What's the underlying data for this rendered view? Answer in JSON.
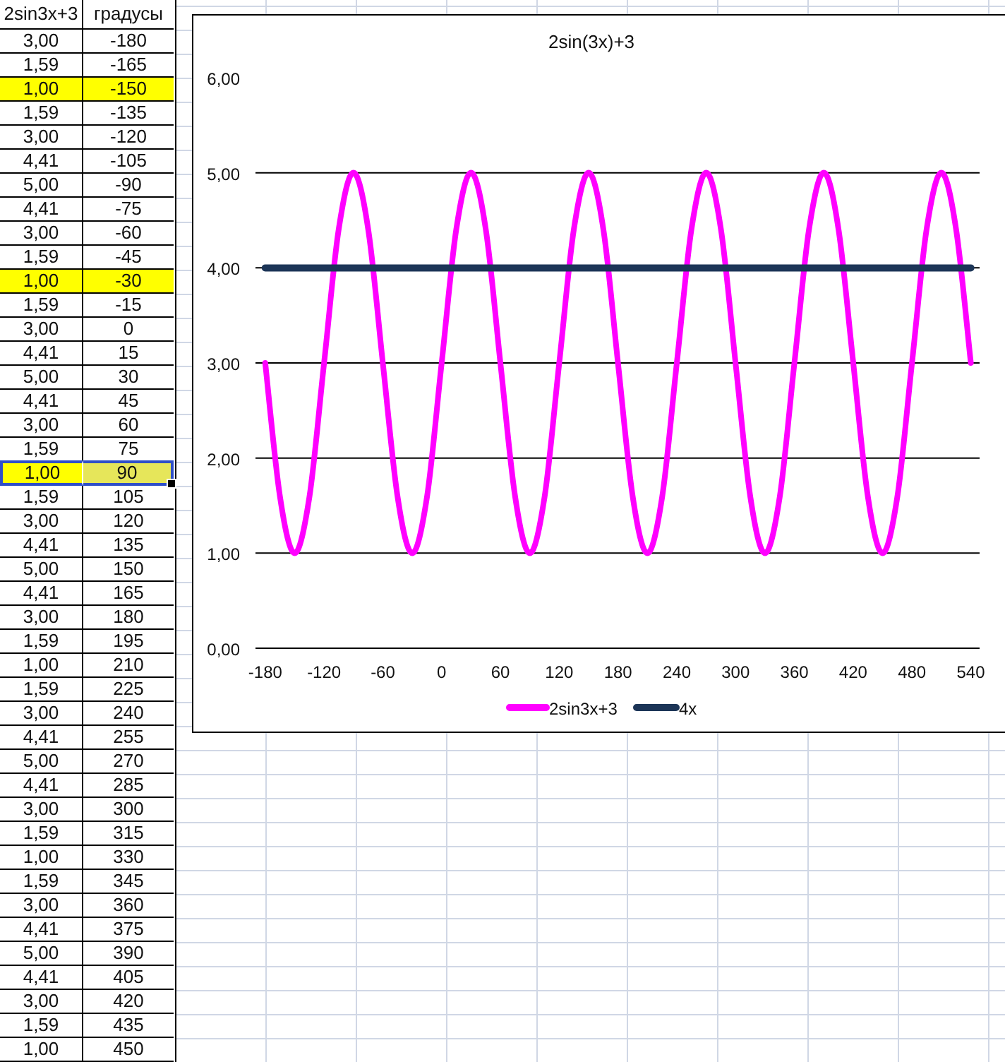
{
  "table": {
    "columns": [
      "2sin3x+3",
      "градусы"
    ],
    "rows": [
      {
        "values": [
          "3,00",
          "-180"
        ],
        "highlighted": false,
        "selected": false
      },
      {
        "values": [
          "1,59",
          "-165"
        ],
        "highlighted": false,
        "selected": false
      },
      {
        "values": [
          "1,00",
          "-150"
        ],
        "highlighted": true,
        "selected": false
      },
      {
        "values": [
          "1,59",
          "-135"
        ],
        "highlighted": false,
        "selected": false
      },
      {
        "values": [
          "3,00",
          "-120"
        ],
        "highlighted": false,
        "selected": false
      },
      {
        "values": [
          "4,41",
          "-105"
        ],
        "highlighted": false,
        "selected": false
      },
      {
        "values": [
          "5,00",
          "-90"
        ],
        "highlighted": false,
        "selected": false
      },
      {
        "values": [
          "4,41",
          "-75"
        ],
        "highlighted": false,
        "selected": false
      },
      {
        "values": [
          "3,00",
          "-60"
        ],
        "highlighted": false,
        "selected": false
      },
      {
        "values": [
          "1,59",
          "-45"
        ],
        "highlighted": false,
        "selected": false
      },
      {
        "values": [
          "1,00",
          "-30"
        ],
        "highlighted": true,
        "selected": false
      },
      {
        "values": [
          "1,59",
          "-15"
        ],
        "highlighted": false,
        "selected": false
      },
      {
        "values": [
          "3,00",
          "0"
        ],
        "highlighted": false,
        "selected": false
      },
      {
        "values": [
          "4,41",
          "15"
        ],
        "highlighted": false,
        "selected": false
      },
      {
        "values": [
          "5,00",
          "30"
        ],
        "highlighted": false,
        "selected": false
      },
      {
        "values": [
          "4,41",
          "45"
        ],
        "highlighted": false,
        "selected": false
      },
      {
        "values": [
          "3,00",
          "60"
        ],
        "highlighted": false,
        "selected": false
      },
      {
        "values": [
          "1,59",
          "75"
        ],
        "highlighted": false,
        "selected": false
      },
      {
        "values": [
          "1,00",
          "90"
        ],
        "highlighted": true,
        "selected": true
      },
      {
        "values": [
          "1,59",
          "105"
        ],
        "highlighted": false,
        "selected": false
      },
      {
        "values": [
          "3,00",
          "120"
        ],
        "highlighted": false,
        "selected": false
      },
      {
        "values": [
          "4,41",
          "135"
        ],
        "highlighted": false,
        "selected": false
      },
      {
        "values": [
          "5,00",
          "150"
        ],
        "highlighted": false,
        "selected": false
      },
      {
        "values": [
          "4,41",
          "165"
        ],
        "highlighted": false,
        "selected": false
      },
      {
        "values": [
          "3,00",
          "180"
        ],
        "highlighted": false,
        "selected": false
      },
      {
        "values": [
          "1,59",
          "195"
        ],
        "highlighted": false,
        "selected": false
      },
      {
        "values": [
          "1,00",
          "210"
        ],
        "highlighted": false,
        "selected": false
      },
      {
        "values": [
          "1,59",
          "225"
        ],
        "highlighted": false,
        "selected": false
      },
      {
        "values": [
          "3,00",
          "240"
        ],
        "highlighted": false,
        "selected": false
      },
      {
        "values": [
          "4,41",
          "255"
        ],
        "highlighted": false,
        "selected": false
      },
      {
        "values": [
          "5,00",
          "270"
        ],
        "highlighted": false,
        "selected": false
      },
      {
        "values": [
          "4,41",
          "285"
        ],
        "highlighted": false,
        "selected": false
      },
      {
        "values": [
          "3,00",
          "300"
        ],
        "highlighted": false,
        "selected": false
      },
      {
        "values": [
          "1,59",
          "315"
        ],
        "highlighted": false,
        "selected": false
      },
      {
        "values": [
          "1,00",
          "330"
        ],
        "highlighted": false,
        "selected": false
      },
      {
        "values": [
          "1,59",
          "345"
        ],
        "highlighted": false,
        "selected": false
      },
      {
        "values": [
          "3,00",
          "360"
        ],
        "highlighted": false,
        "selected": false
      },
      {
        "values": [
          "4,41",
          "375"
        ],
        "highlighted": false,
        "selected": false
      },
      {
        "values": [
          "5,00",
          "390"
        ],
        "highlighted": false,
        "selected": false
      },
      {
        "values": [
          "4,41",
          "405"
        ],
        "highlighted": false,
        "selected": false
      },
      {
        "values": [
          "3,00",
          "420"
        ],
        "highlighted": false,
        "selected": false
      },
      {
        "values": [
          "1,59",
          "435"
        ],
        "highlighted": false,
        "selected": false
      },
      {
        "values": [
          "1,00",
          "450"
        ],
        "highlighted": false,
        "selected": false
      }
    ]
  },
  "chart": {
    "chart_data": {
      "type": "line",
      "title": "2sin(3x)+3",
      "x": [
        -180,
        -165,
        -150,
        -135,
        -120,
        -105,
        -90,
        -75,
        -60,
        -45,
        -30,
        -15,
        0,
        15,
        30,
        45,
        60,
        75,
        90,
        105,
        120,
        135,
        150,
        165,
        180,
        195,
        210,
        225,
        240,
        255,
        270,
        285,
        300,
        315,
        330,
        345,
        360,
        375,
        390,
        405,
        420,
        435,
        450,
        465,
        480,
        495,
        510,
        525,
        540
      ],
      "series": [
        {
          "name": "2sin3x+3",
          "color": "#ff00ff",
          "values": [
            3,
            1.59,
            1,
            1.59,
            3,
            4.41,
            5,
            4.41,
            3,
            1.59,
            1,
            1.59,
            3,
            4.41,
            5,
            4.41,
            3,
            1.59,
            1,
            1.59,
            3,
            4.41,
            5,
            4.41,
            3,
            1.59,
            1,
            1.59,
            3,
            4.41,
            5,
            4.41,
            3,
            1.59,
            1,
            1.59,
            3,
            4.41,
            5,
            4.41,
            3,
            1.59,
            1,
            1.59,
            3,
            4.41,
            5,
            4.41,
            3
          ]
        },
        {
          "name": "4x",
          "color": "#1c3557",
          "values": [
            4,
            4,
            4,
            4,
            4,
            4,
            4,
            4,
            4,
            4,
            4,
            4,
            4,
            4,
            4,
            4,
            4,
            4,
            4,
            4,
            4,
            4,
            4,
            4,
            4,
            4,
            4,
            4,
            4,
            4,
            4,
            4,
            4,
            4,
            4,
            4,
            4,
            4,
            4,
            4,
            4,
            4,
            4,
            4,
            4,
            4,
            4,
            4,
            4
          ]
        }
      ],
      "xlim": [
        -190,
        549
      ],
      "ylim": [
        0,
        6
      ],
      "grid": true,
      "legend": true,
      "xticks": [
        -180,
        -120,
        -60,
        0,
        60,
        120,
        180,
        240,
        300,
        360,
        420,
        480,
        540
      ],
      "yticks": [
        {
          "value": 0,
          "label": "0,00"
        },
        {
          "value": 1,
          "label": "1,00"
        },
        {
          "value": 2,
          "label": "2,00"
        },
        {
          "value": 3,
          "label": "3,00"
        },
        {
          "value": 4,
          "label": "4,00"
        },
        {
          "value": 5,
          "label": "5,00"
        },
        {
          "value": 6,
          "label": "6,00"
        }
      ]
    }
  }
}
